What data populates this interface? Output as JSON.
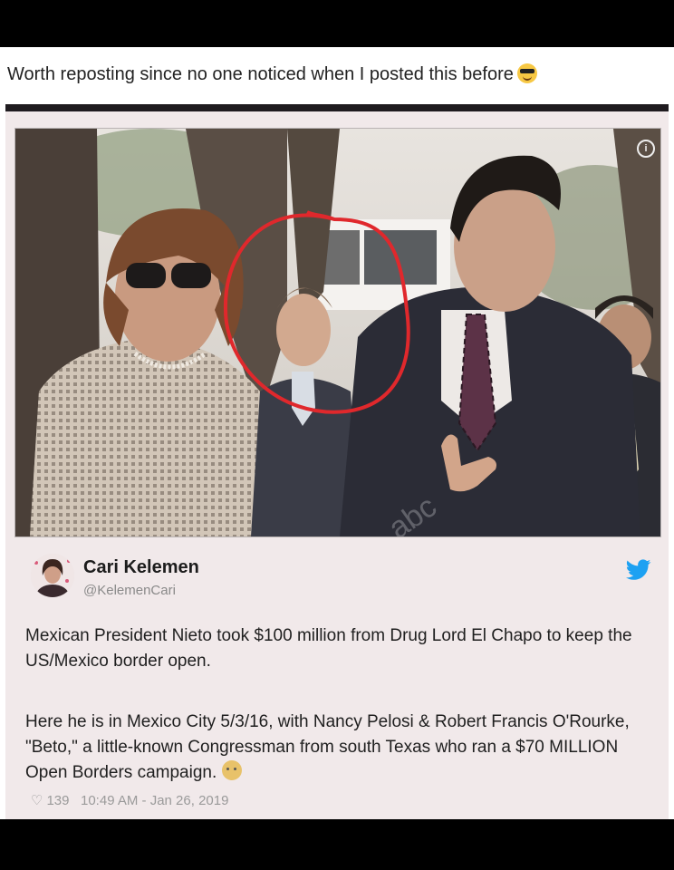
{
  "post": {
    "caption": "Worth reposting since no one noticed when I posted this before",
    "caption_emoji": "sunglasses-emoji"
  },
  "tweet": {
    "author_name": "Cari Kelemen",
    "author_handle": "@KelemenCari",
    "paragraph_1": "Mexican President Nieto took $100 million from Drug Lord El Chapo to keep the US/Mexico border open.",
    "paragraph_2": "Here he is in Mexico City 5/3/16, with Nancy Pelosi & Robert Francis O'Rourke, \"Beto,\" a little-known Congressman from south Texas who ran a  $70 MILLION Open Borders campaign.",
    "trailing_emoji": "thinking-emoji",
    "like_count": "139",
    "timestamp": "10:49 AM - Jan 26, 2019",
    "platform_icon": "twitter-bird-icon",
    "photo_info_icon": "i"
  },
  "colors": {
    "card_bg": "#f1e9ea",
    "circle_highlight": "#e0282c",
    "twitter_blue": "#1da1f2"
  }
}
